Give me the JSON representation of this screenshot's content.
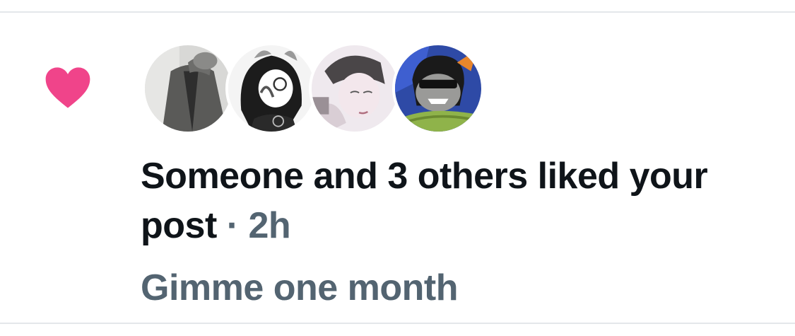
{
  "notification": {
    "type_icon": "heart-icon",
    "type_icon_color": "#f0448a",
    "avatars": [
      {
        "name": "avatar-1",
        "description": "grayscale suit"
      },
      {
        "name": "avatar-2",
        "description": "monochrome cartoon"
      },
      {
        "name": "avatar-3",
        "description": "anime sketch"
      },
      {
        "name": "avatar-4",
        "description": "troll with sunglasses"
      }
    ],
    "headline": "Someone and 3 others liked your post",
    "separator": "·",
    "time": "2h",
    "post_text": "Gimme one month"
  },
  "colors": {
    "primary_text": "#0f1419",
    "secondary_text": "#536471",
    "divider": "#e4e7ea"
  }
}
